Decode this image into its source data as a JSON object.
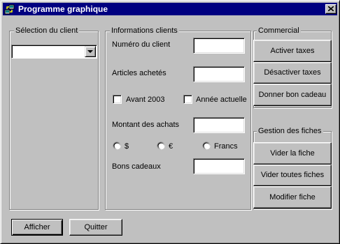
{
  "window": {
    "title": "Programme graphique"
  },
  "client_selection": {
    "legend": "Sélection du client",
    "selected_value": ""
  },
  "client_info": {
    "legend": "Informations clients",
    "client_number_label": "Numéro du client",
    "client_number_value": "",
    "articles_label": "Articles achetés",
    "articles_value": "",
    "before_2003_label": "Avant 2003",
    "before_2003_checked": false,
    "current_year_label": "Année actuelle",
    "current_year_checked": false,
    "purchase_amount_label": "Montant des achats",
    "purchase_amount_value": "",
    "currency_options": [
      {
        "label": "$",
        "selected": false
      },
      {
        "label": "€",
        "selected": false
      },
      {
        "label": "Francs",
        "selected": false
      }
    ],
    "gift_vouchers_label": "Bons cadeaux",
    "gift_vouchers_value": ""
  },
  "commercial": {
    "legend": "Commercial",
    "activate_taxes": "Activer taxes",
    "deactivate_taxes": "Désactiver taxes",
    "give_gift_voucher": "Donner bon cadeau"
  },
  "records": {
    "legend": "Gestion des fiches",
    "clear_record": "Vider la fiche",
    "clear_all_records": "Vider toutes fiches",
    "edit_record": "Modifier fiche"
  },
  "footer": {
    "show_button": "Afficher",
    "quit_button": "Quitter"
  }
}
